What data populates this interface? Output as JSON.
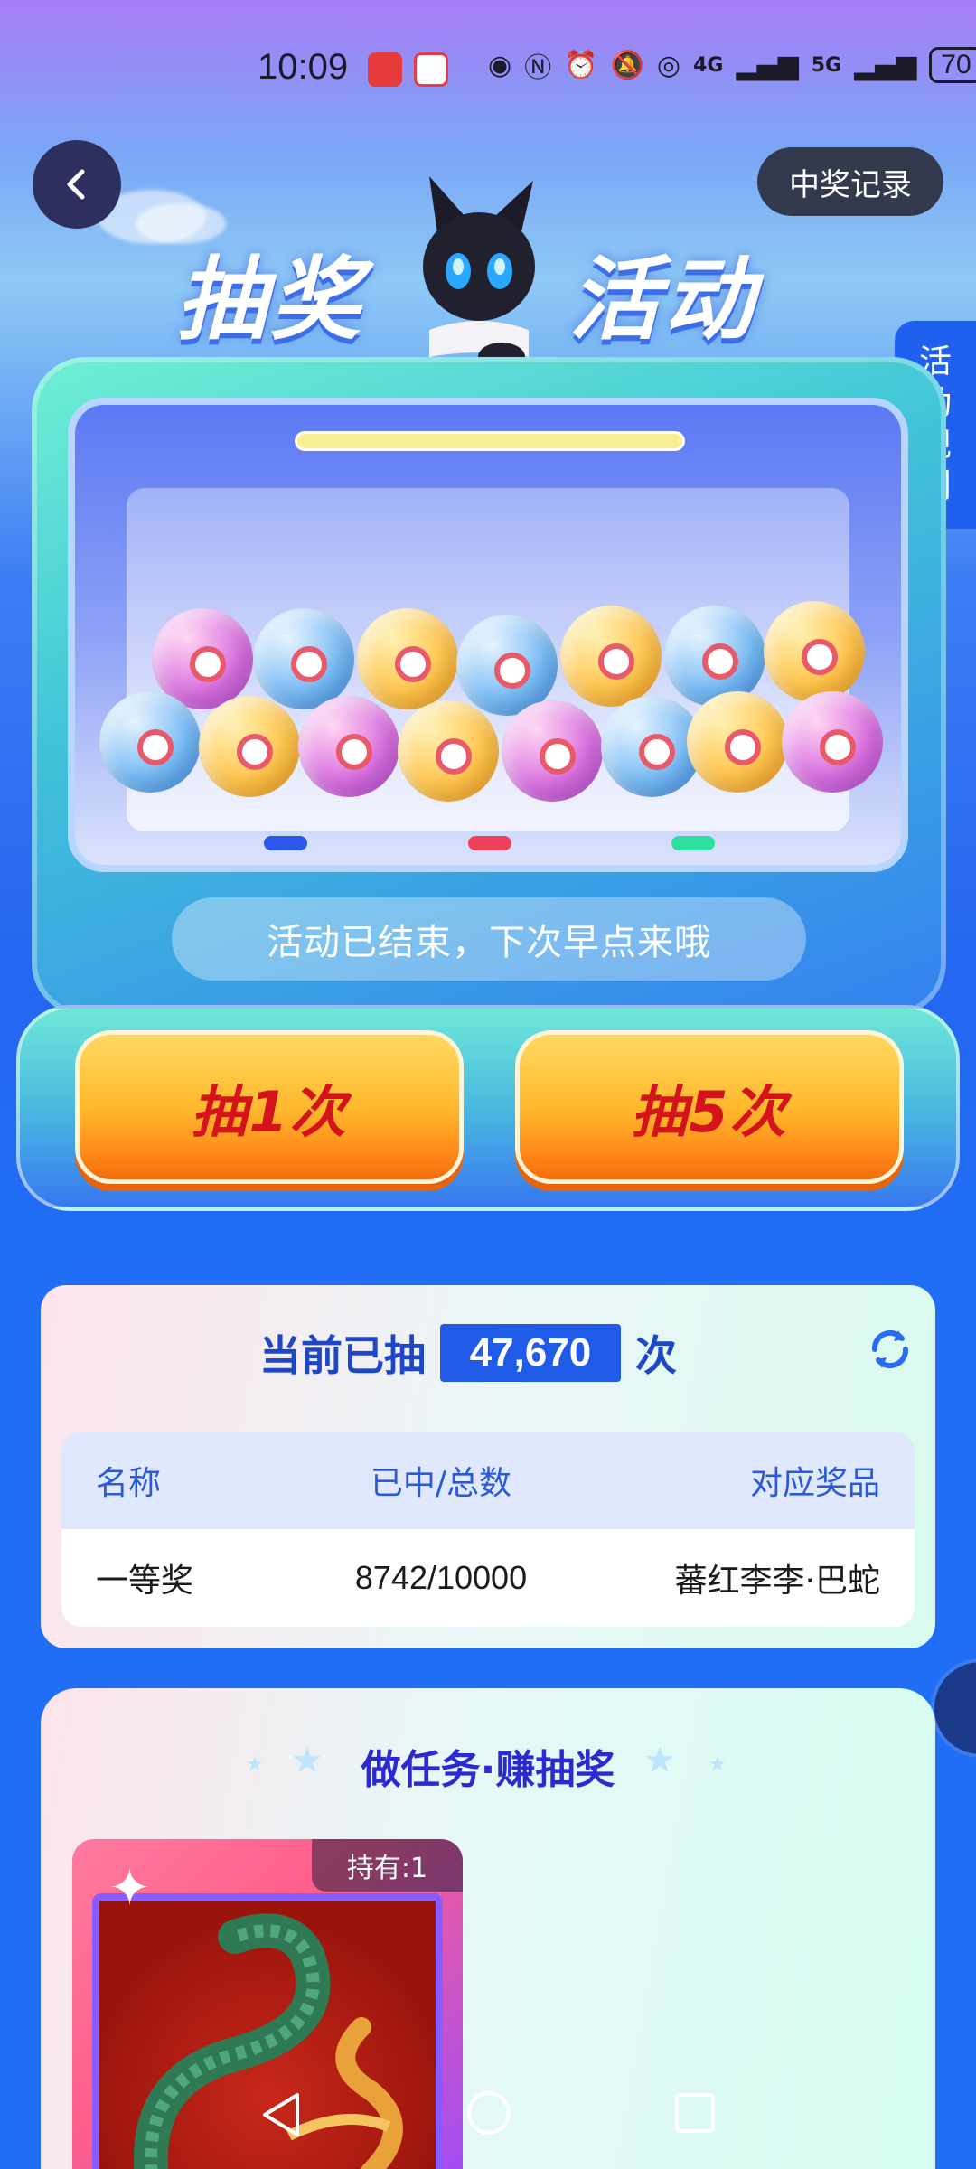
{
  "status_bar": {
    "time": "10:09",
    "network_4g": "4G",
    "network_5g": "5G",
    "battery": "70"
  },
  "header": {
    "title_left": "抽奖",
    "title_right": "活动",
    "record_button": "中奖记录",
    "rules_tab": [
      "活",
      "动",
      "规",
      "则"
    ]
  },
  "machine": {
    "status_text": "活动已结束，下次早点来哦",
    "draw_once": "抽1次",
    "draw_five": "抽5次"
  },
  "stats": {
    "prefix": "当前已抽",
    "count": "47,670",
    "suffix": "次",
    "table": {
      "headers": [
        "名称",
        "已中/总数",
        "对应奖品"
      ],
      "rows": [
        [
          "一等奖",
          "8742/10000",
          "蕃红李李·巴蛇"
        ]
      ]
    }
  },
  "tasks": {
    "title": "做任务·赚抽奖",
    "holding": "持有:1"
  },
  "colors": {
    "accent_blue": "#1f5be6",
    "button_orange": "#ffb92e",
    "button_text_red": "#d4141a"
  }
}
